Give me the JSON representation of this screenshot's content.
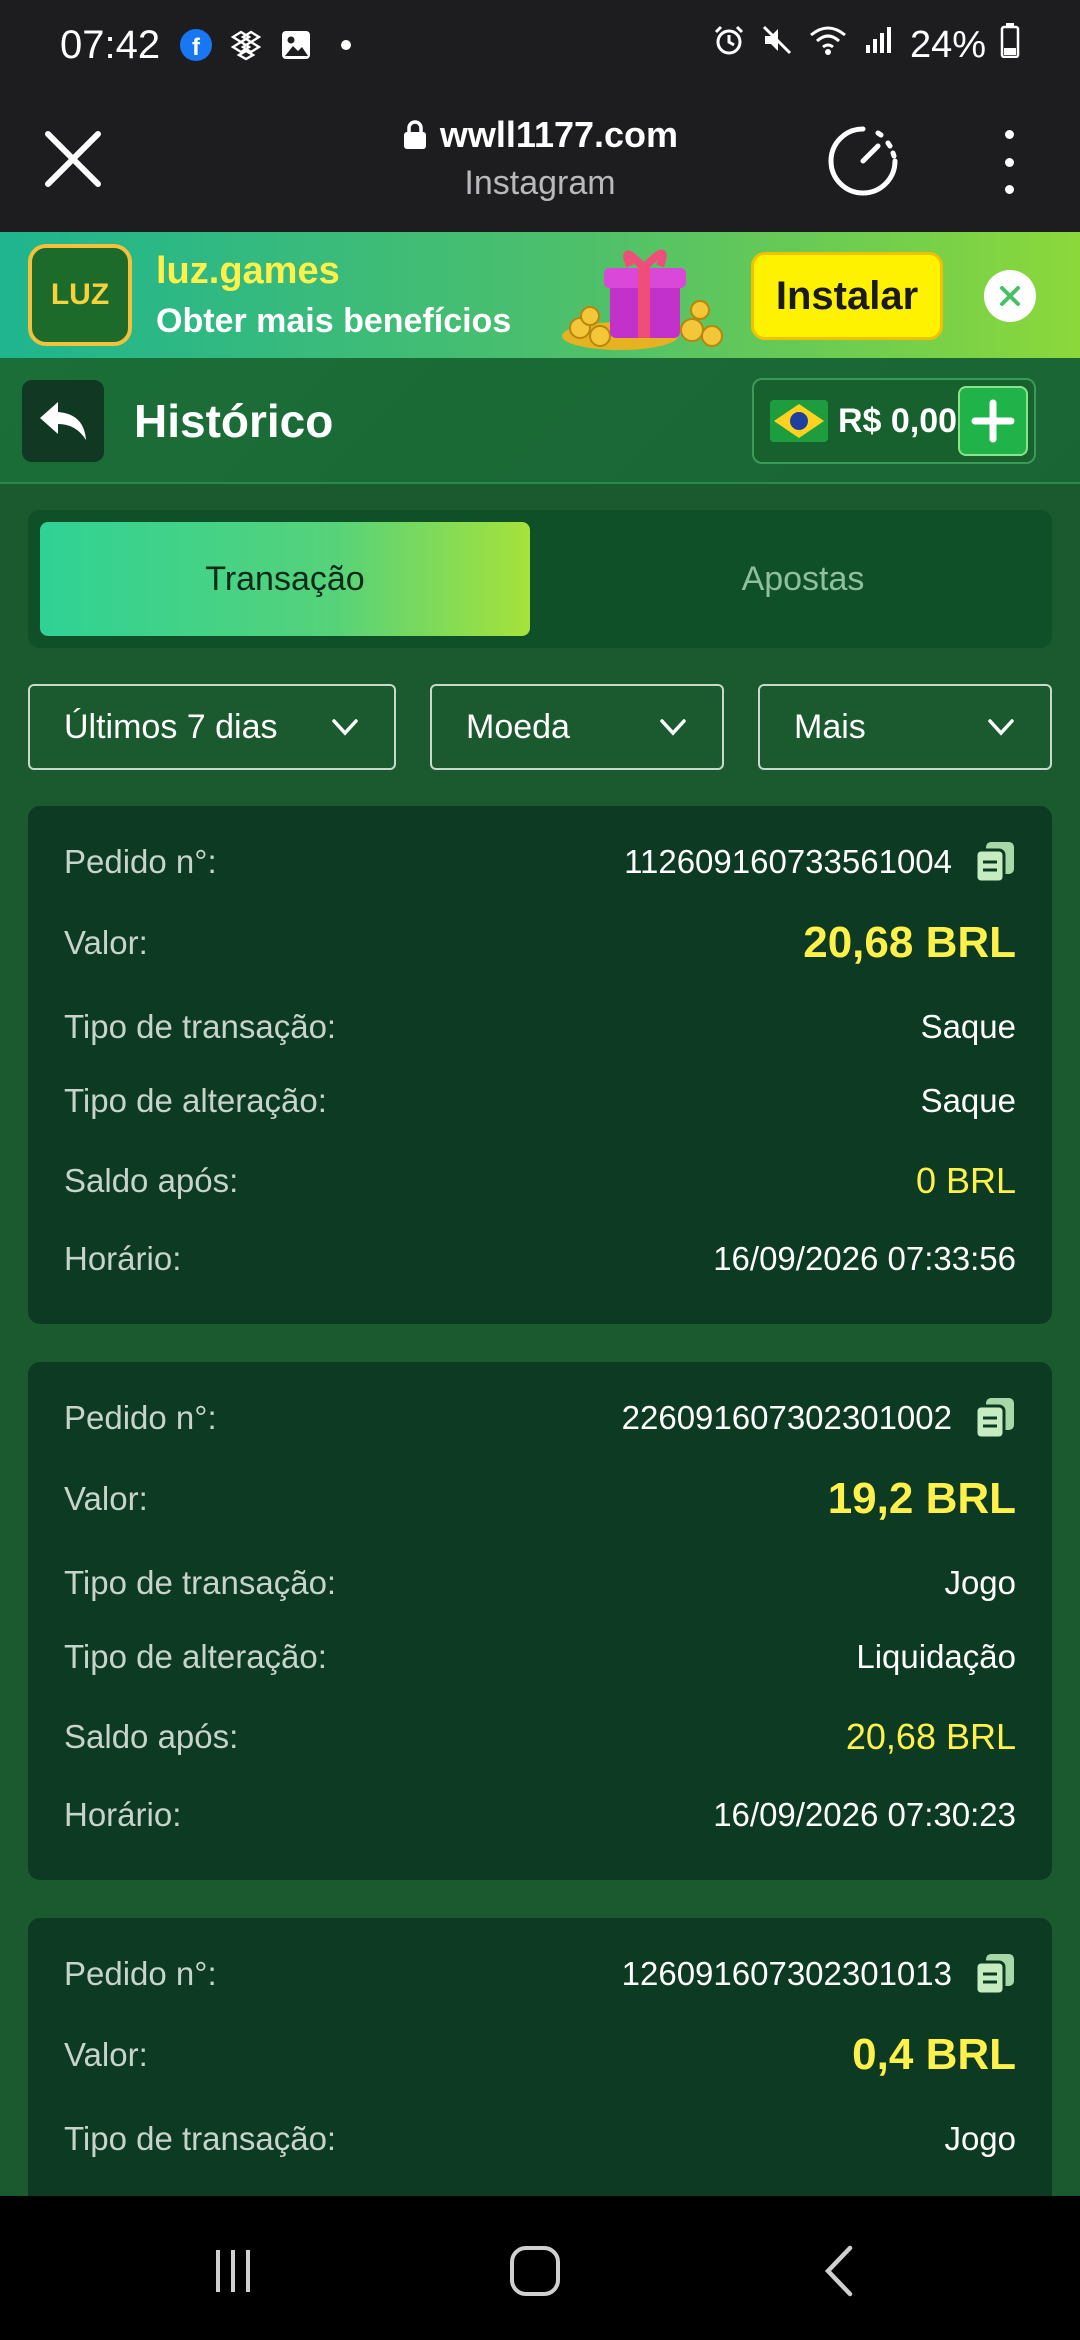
{
  "status_bar": {
    "time": "07:42",
    "battery": "24%",
    "left_icons": [
      "facebook-icon",
      "dropbox-icon",
      "gallery-icon",
      "dot-icon"
    ],
    "right_icons": [
      "alarm-icon",
      "mute-icon",
      "wifi-icon",
      "signal-icon",
      "battery-icon"
    ]
  },
  "browser": {
    "url": "wwll1177.com",
    "subtitle": "Instagram"
  },
  "banner": {
    "app_name": "luz.games",
    "logo_text": "LUZ",
    "tagline": "Obter mais benefícios",
    "install_label": "Instalar"
  },
  "header": {
    "title": "Histórico",
    "balance": "R$ 0,00"
  },
  "tabs": [
    {
      "label": "Transação",
      "active": true
    },
    {
      "label": "Apostas",
      "active": false
    }
  ],
  "filters": [
    {
      "label": "Últimos 7 dias"
    },
    {
      "label": "Moeda"
    },
    {
      "label": "Mais"
    }
  ],
  "labels": {
    "order": "Pedido n°:",
    "value": "Valor:",
    "tx_type": "Tipo de transação:",
    "change_type": "Tipo de alteração:",
    "balance_after": "Saldo após:",
    "time": "Horário:"
  },
  "transactions": [
    {
      "order_no": "112609160733561004",
      "value": "20,68 BRL",
      "tx_type": "Saque",
      "change_type": "Saque",
      "balance_after": "0 BRL",
      "time": "16/09/2026 07:33:56"
    },
    {
      "order_no": "226091607302301002",
      "value": "19,2 BRL",
      "tx_type": "Jogo",
      "change_type": "Liquidação",
      "balance_after": "20,68 BRL",
      "time": "16/09/2026 07:30:23"
    },
    {
      "order_no": "126091607302301013",
      "value": "0,4 BRL",
      "tx_type": "Jogo"
    }
  ],
  "colors": {
    "page_bg": "#1a5a2e",
    "card_bg": "#0c3a22",
    "amount": "#fff14a",
    "tab_active_start": "#2fd295",
    "tab_active_end": "#a6e23a"
  }
}
